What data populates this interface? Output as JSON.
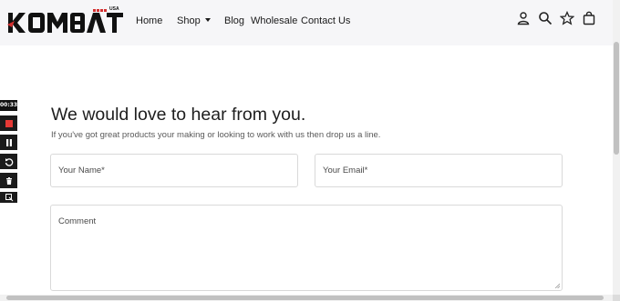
{
  "header": {
    "logo": {
      "text": "KOMBAT",
      "badge": "USA",
      "accent_color": "#d32f2f"
    },
    "nav": [
      {
        "label": "Home"
      },
      {
        "label": "Shop"
      },
      {
        "label": "Blog"
      },
      {
        "label": "Wholesale"
      },
      {
        "label": "Contact Us"
      }
    ],
    "icons": [
      "account-icon",
      "search-icon",
      "wishlist-star-icon",
      "cart-bag-icon"
    ]
  },
  "recorder": {
    "time": "00:33",
    "buttons": [
      "stop-icon",
      "pause-icon",
      "restart-icon",
      "delete-icon",
      "cursor-icon"
    ],
    "stop_color": "#e53935"
  },
  "content": {
    "title": "We would love to hear from you.",
    "subtitle": "If you've got great products your making or looking to work with us then drop us a line."
  },
  "form": {
    "name_placeholder": "Your Name*",
    "email_placeholder": "Your Email*",
    "comment_placeholder": "Comment"
  }
}
